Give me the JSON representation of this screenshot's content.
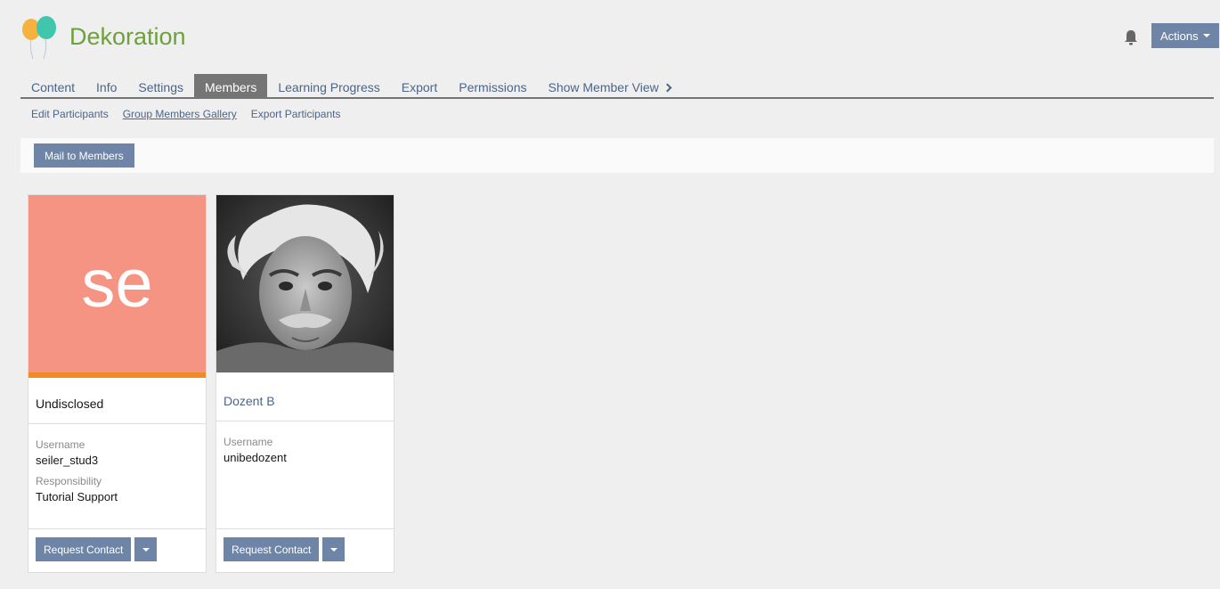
{
  "header": {
    "title": "Dekoration",
    "actions_label": "Actions",
    "logo_icon": "balloons-icon",
    "notification_icon": "bell-icon"
  },
  "tabs": [
    {
      "label": "Content",
      "active": false
    },
    {
      "label": "Info",
      "active": false
    },
    {
      "label": "Settings",
      "active": false
    },
    {
      "label": "Members",
      "active": true
    },
    {
      "label": "Learning Progress",
      "active": false
    },
    {
      "label": "Export",
      "active": false
    },
    {
      "label": "Permissions",
      "active": false
    },
    {
      "label": "Show Member View",
      "active": false
    }
  ],
  "subtabs": [
    {
      "label": "Edit Participants",
      "active": false
    },
    {
      "label": "Group Members Gallery",
      "active": true
    },
    {
      "label": "Export Participants",
      "active": false
    }
  ],
  "toolbar": {
    "mail_label": "Mail to Members"
  },
  "members": [
    {
      "avatar_initials": "se",
      "name": "Undisclosed",
      "username_label": "Username",
      "username": "seiler_stud3",
      "responsibility_label": "Responsibility",
      "responsibility": "Tutorial Support",
      "request_label": "Request Contact"
    },
    {
      "name": "Dozent B",
      "username_label": "Username",
      "username": "unibedozent",
      "request_label": "Request Contact"
    }
  ],
  "colors": {
    "brand_green": "#6ea03c",
    "button_blue": "#6e85a7",
    "link_blue": "#4c6586",
    "avatar_salmon": "#f59482",
    "avatar_accent": "#f08a24"
  }
}
